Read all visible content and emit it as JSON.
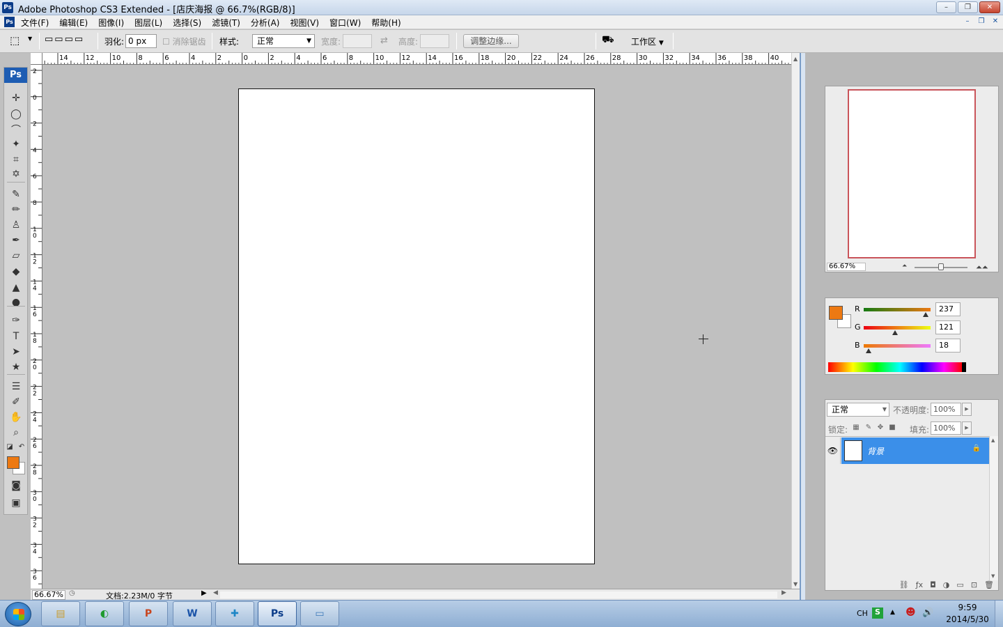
{
  "window": {
    "title": "Adobe Photoshop CS3 Extended - [店庆海报 @ 66.7%(RGB/8)]",
    "app_badge": "Ps",
    "controls": {
      "minimize": "–",
      "restore": "❐",
      "close": "✕"
    }
  },
  "menu": {
    "items": [
      "文件(F)",
      "编辑(E)",
      "图像(I)",
      "图层(L)",
      "选择(S)",
      "滤镜(T)",
      "分析(A)",
      "视图(V)",
      "窗口(W)",
      "帮助(H)"
    ],
    "doc_controls": {
      "minimize": "–",
      "restore": "❐",
      "close": "✕"
    }
  },
  "options": {
    "feather_label": "羽化:",
    "feather_value": "0 px",
    "antialias_label": "消除锯齿",
    "style_label": "样式:",
    "style_value": "正常",
    "width_label": "宽度:",
    "height_label": "高度:",
    "refine_edge": "调整边缘...",
    "workspace": "工作区"
  },
  "tools": {
    "badge": "Ps",
    "items": [
      {
        "name": "move-tool",
        "glyph": "✛"
      },
      {
        "name": "elliptical-marquee-tool",
        "glyph": "◯"
      },
      {
        "name": "lasso-tool",
        "glyph": "⌒"
      },
      {
        "name": "magic-wand-tool",
        "glyph": "✦"
      },
      {
        "name": "crop-tool",
        "glyph": "⌗"
      },
      {
        "name": "slice-tool",
        "glyph": "✡"
      },
      {
        "name": "healing-brush-tool",
        "glyph": "✎"
      },
      {
        "name": "brush-tool",
        "glyph": "✏"
      },
      {
        "name": "clone-stamp-tool",
        "glyph": "♙"
      },
      {
        "name": "history-brush-tool",
        "glyph": "✒"
      },
      {
        "name": "eraser-tool",
        "glyph": "▱"
      },
      {
        "name": "paint-bucket-tool",
        "glyph": "◆"
      },
      {
        "name": "blur-tool",
        "glyph": "▲"
      },
      {
        "name": "dodge-tool",
        "glyph": "●"
      },
      {
        "name": "pen-tool",
        "glyph": "✑"
      },
      {
        "name": "type-tool",
        "glyph": "T"
      },
      {
        "name": "path-selection-tool",
        "glyph": "➤"
      },
      {
        "name": "custom-shape-tool",
        "glyph": "★"
      },
      {
        "name": "notes-tool",
        "glyph": "☰"
      },
      {
        "name": "eyedropper-tool",
        "glyph": "✐"
      },
      {
        "name": "hand-tool",
        "glyph": "✋"
      },
      {
        "name": "zoom-tool",
        "glyph": "⌕"
      }
    ],
    "foreground_color": "#ED7912",
    "background_color": "#FFFFFF"
  },
  "rulers": {
    "top_labels": [
      "14",
      "12",
      "10",
      "8",
      "6",
      "4",
      "2",
      "0",
      "2",
      "4",
      "6",
      "8",
      "10",
      "12",
      "14",
      "16",
      "18",
      "20",
      "22",
      "24",
      "26",
      "28",
      "30",
      "32",
      "34",
      "36",
      "38",
      "40"
    ],
    "left_labels": [
      "2",
      "0",
      "2",
      "4",
      "6",
      "8",
      "10",
      "12",
      "14",
      "16",
      "18",
      "20",
      "22",
      "24",
      "26",
      "28",
      "30",
      "32",
      "34",
      "36"
    ]
  },
  "status": {
    "zoom": "66.67%",
    "doc_info": "文档:2.23M/0 字节"
  },
  "navigator": {
    "zoom": "66.67%",
    "zoom_level": 0.5
  },
  "color_panel": {
    "channels": [
      {
        "label": "R",
        "value": "237",
        "gradient": "linear-gradient(90deg,#157a12,#ed7912)",
        "level": 0.93
      },
      {
        "label": "G",
        "value": "121",
        "gradient": "linear-gradient(90deg,#ed0012,#edff12)",
        "level": 0.47
      },
      {
        "label": "B",
        "value": "18",
        "gradient": "linear-gradient(90deg,#ed7900,#ed79ff)",
        "level": 0.07
      }
    ]
  },
  "layers_panel": {
    "blend_mode": "正常",
    "opacity_label": "不透明度:",
    "opacity_value": "100%",
    "lock_label": "锁定:",
    "fill_label": "填充:",
    "fill_value": "100%",
    "layers": [
      {
        "name": "背景",
        "visible": true,
        "locked": true
      }
    ]
  },
  "taskbar": {
    "apps": [
      "file-explorer",
      "browser",
      "powerpoint",
      "word",
      "app",
      "photoshop",
      "image-viewer"
    ],
    "tray": {
      "input": "CH",
      "time": "9:59",
      "date": "2014/5/30"
    }
  }
}
